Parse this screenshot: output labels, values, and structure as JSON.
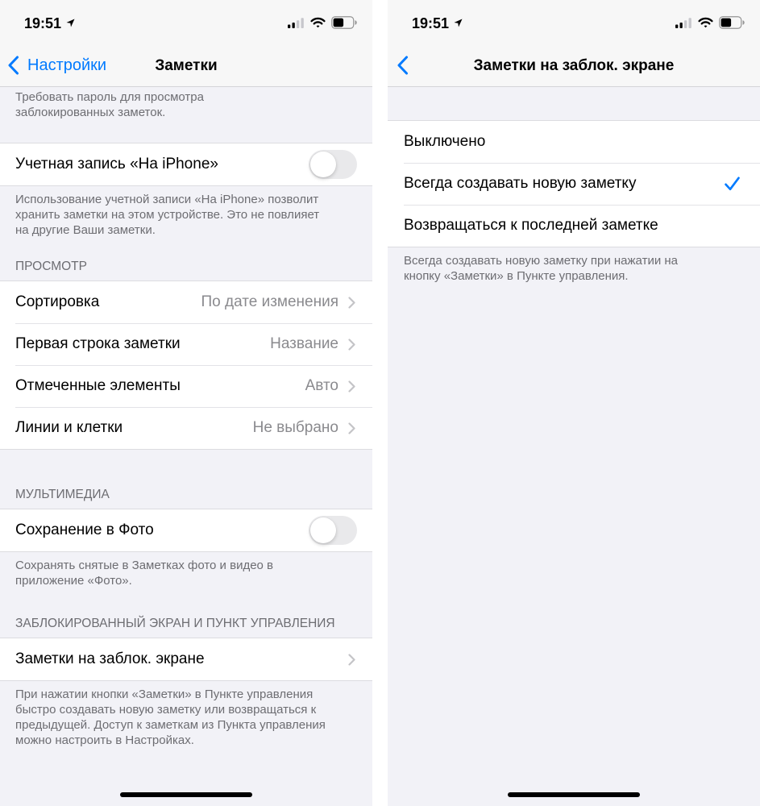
{
  "theme": {
    "accent": "#007aff",
    "background": "#f2f2f7",
    "secondary_text": "#8a8a8e"
  },
  "left": {
    "status_bar": {
      "time": "19:51",
      "signal_bars": 2,
      "battery_level": 0.55,
      "icons": [
        "location-icon",
        "signal-icon",
        "wifi-icon",
        "battery-icon"
      ]
    },
    "nav": {
      "back_icon": "chevron-left-icon",
      "back_label": "Настройки",
      "title": "Заметки"
    },
    "password_footer": "Требовать пароль для просмотра\nзаблокированных заметок.",
    "account": {
      "label": "Учетная запись «На iPhone»",
      "toggle_on": false,
      "footer": "Использование учетной записи «На iPhone» позволит\nхранить заметки на этом устройстве. Это не повлияет\nна другие Ваши заметки."
    },
    "view_section": {
      "header": "ПРОСМОТР",
      "row_icon": "chevron-right-icon",
      "rows": [
        {
          "label": "Сортировка",
          "value": "По дате изменения"
        },
        {
          "label": "Первая строка заметки",
          "value": "Название"
        },
        {
          "label": "Отмеченные элементы",
          "value": "Авто"
        },
        {
          "label": "Линии и клетки",
          "value": "Не выбрано"
        }
      ]
    },
    "media_section": {
      "header": "МУЛЬТИМЕДИА",
      "label": "Сохранение в Фото",
      "toggle_on": false,
      "footer": "Сохранять снятые в Заметках фото и видео в\nприложение «Фото»."
    },
    "lock_section": {
      "header": "ЗАБЛОКИРОВАННЫЙ ЭКРАН И ПУНКТ УПРАВЛЕНИЯ",
      "label": "Заметки на заблок. экране",
      "footer": "При нажатии кнопки «Заметки» в Пункте управления\nбыстро создавать новую заметку или возвращаться к\nпредыдущей. Доступ к заметкам из Пункта управления\nможно настроить в Настройках."
    }
  },
  "right": {
    "status_bar": {
      "time": "19:51",
      "signal_bars": 2,
      "battery_level": 0.55,
      "icons": [
        "location-icon",
        "signal-icon",
        "wifi-icon",
        "battery-icon"
      ]
    },
    "nav": {
      "back_icon": "chevron-left-icon",
      "title": "Заметки на заблок. экране"
    },
    "options": {
      "items": [
        "Выключено",
        "Всегда создавать новую заметку",
        "Возвращаться к последней заметке"
      ],
      "selected_index": 1,
      "selected_icon": "checkmark-icon"
    },
    "footer": "Всегда создавать новую заметку при нажатии на\nкнопку «Заметки» в Пункте управления."
  }
}
